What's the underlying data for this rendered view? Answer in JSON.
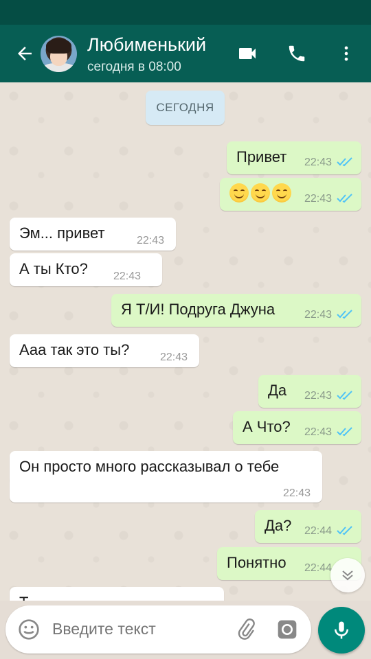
{
  "header": {
    "contact_name": "Любименький",
    "last_seen": "сегодня в 08:00",
    "accent": "#075e54"
  },
  "chat": {
    "date_chip": "СЕГОДНЯ",
    "messages": [
      {
        "dir": "out",
        "text": "Привет",
        "time": "22:43",
        "read": true
      },
      {
        "dir": "out",
        "text": "😊😊😊",
        "time": "22:43",
        "read": true
      },
      {
        "dir": "in",
        "text": "Эм... привет",
        "time": "22:43"
      },
      {
        "dir": "in",
        "text": "А ты Кто?",
        "time": "22:43"
      },
      {
        "dir": "out",
        "text": "Я Т/И! Подруга Джуна",
        "time": "22:43",
        "read": true
      },
      {
        "dir": "in",
        "text": "Ааа так это ты?",
        "time": "22:43"
      },
      {
        "dir": "out",
        "text": "Да",
        "time": "22:43",
        "read": true
      },
      {
        "dir": "out",
        "text": "А Что?",
        "time": "22:43",
        "read": true
      },
      {
        "dir": "in",
        "text": "Он просто много рассказывал о тебе",
        "time": "22:43"
      },
      {
        "dir": "out",
        "text": "Да?",
        "time": "22:44",
        "read": true
      },
      {
        "dir": "out",
        "text": "Понятно",
        "time": "22:44",
        "read": true
      },
      {
        "dir": "in",
        "text": "Т",
        "time": ""
      }
    ]
  },
  "composer": {
    "placeholder": "Введите текст"
  },
  "icons": {
    "back": "arrow-left-icon",
    "video": "video-call-icon",
    "call": "phone-icon",
    "menu": "more-vert-icon",
    "emoji": "emoji-icon",
    "attach": "paperclip-icon",
    "camera": "camera-icon",
    "mic": "mic-icon",
    "scroll": "chevron-double-down-icon",
    "read": "double-check-icon"
  },
  "colors": {
    "outgoing_bubble": "#dcf8c6",
    "incoming_bubble": "#ffffff",
    "read_ticks": "#4fc3f7",
    "mic_button": "#00897b"
  }
}
